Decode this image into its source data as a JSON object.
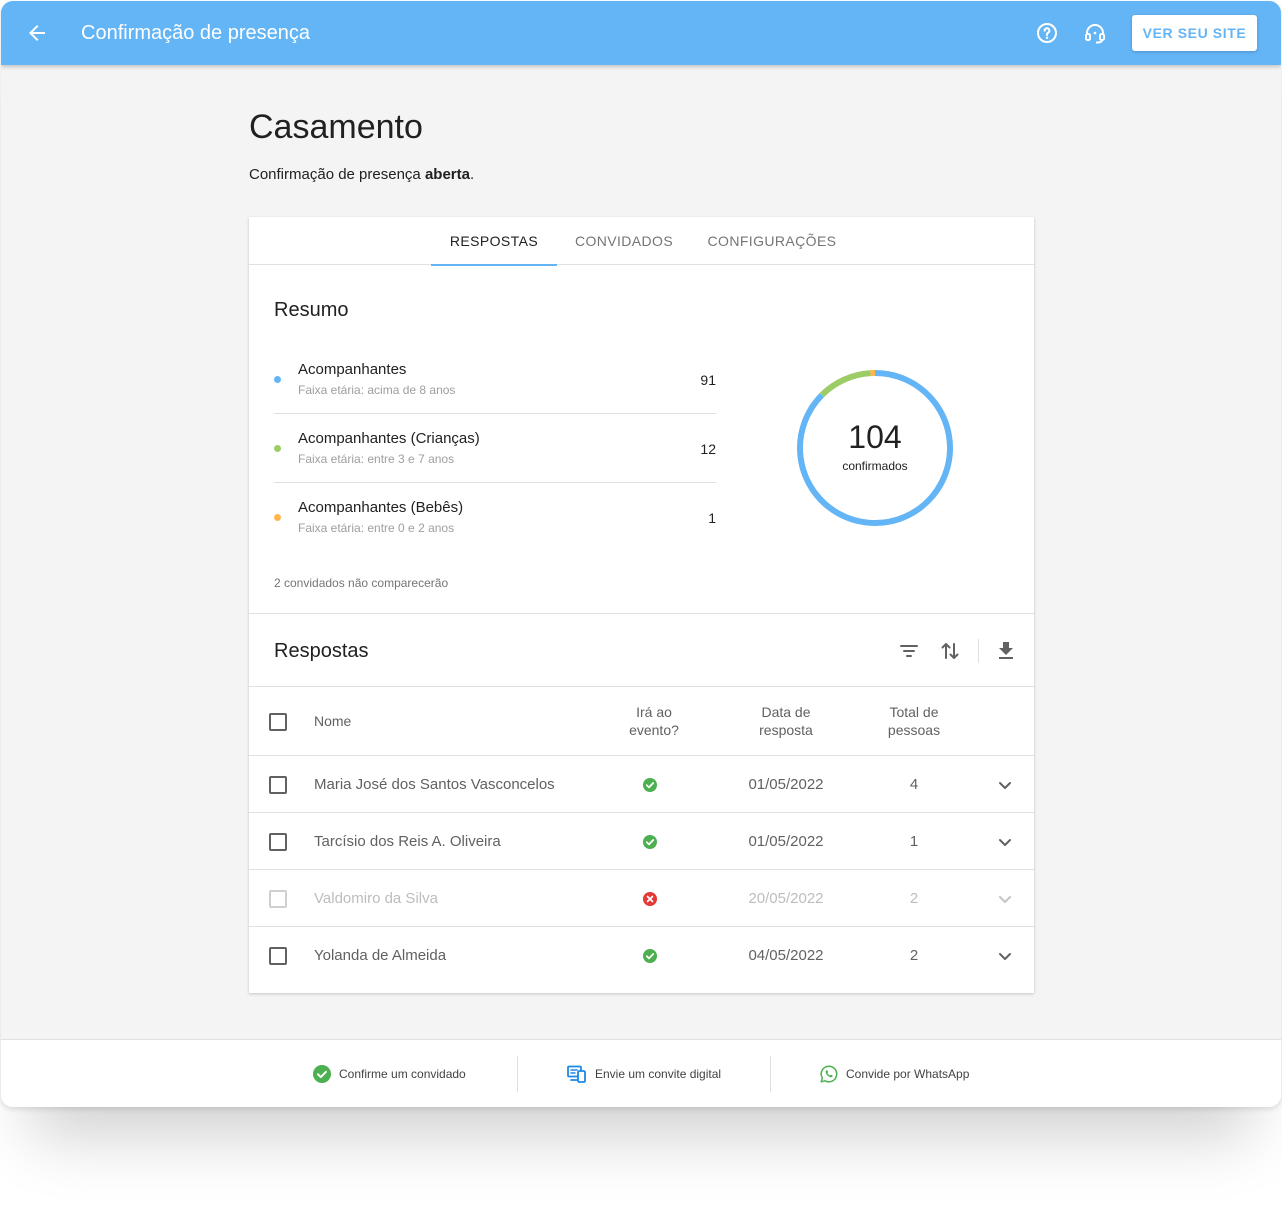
{
  "appbar": {
    "title": "Confirmação de presença",
    "site_button": "VER SEU SITE",
    "color": "#64b5f6"
  },
  "page": {
    "title": "Casamento",
    "status_prefix": "Confirmação de presença ",
    "status_value": "aberta",
    "status_suffix": "."
  },
  "tabs": [
    {
      "label": "RESPOSTAS",
      "active": true
    },
    {
      "label": "CONVIDADOS",
      "active": false
    },
    {
      "label": "CONFIGURAÇÕES",
      "active": false
    }
  ],
  "summary": {
    "title": "Resumo",
    "items": [
      {
        "label": "Acompanhantes",
        "sub": "Faixa etária: acima de 8 anos",
        "value": "91",
        "color": "#64b5f6"
      },
      {
        "label": "Acompanhantes (Crianças)",
        "sub": "Faixa etária: entre 3 e 7 anos",
        "value": "12",
        "color": "#9ccc65"
      },
      {
        "label": "Acompanhantes (Bebês)",
        "sub": "Faixa etária: entre 0 e 2 anos",
        "value": "1",
        "color": "#ffb74d"
      }
    ],
    "absent_note": "2 convidados não comparecerão",
    "total": "104",
    "total_label": "confirmados",
    "donut_values": [
      91,
      12,
      1
    ]
  },
  "responses": {
    "title": "Respostas",
    "headers": {
      "name": "Nome",
      "attending_1": "Irá ao",
      "attending_2": "evento?",
      "date_1": "Data de",
      "date_2": "resposta",
      "total_1": "Total de",
      "total_2": "pessoas"
    },
    "rows": [
      {
        "name": "Maria José dos Santos Vasconcelos",
        "attending": true,
        "date": "01/05/2022",
        "total": "4"
      },
      {
        "name": "Tarcísio dos Reis A. Oliveira",
        "attending": true,
        "date": "01/05/2022",
        "total": "1"
      },
      {
        "name": "Valdomiro da Silva",
        "attending": false,
        "date": "20/05/2022",
        "total": "2"
      },
      {
        "name": "Yolanda de Almeida",
        "attending": true,
        "date": "04/05/2022",
        "total": "2"
      }
    ]
  },
  "footer": {
    "confirm": "Confirme um convidado",
    "invite": "Envie um convite digital",
    "whatsapp": "Convide por WhatsApp"
  }
}
